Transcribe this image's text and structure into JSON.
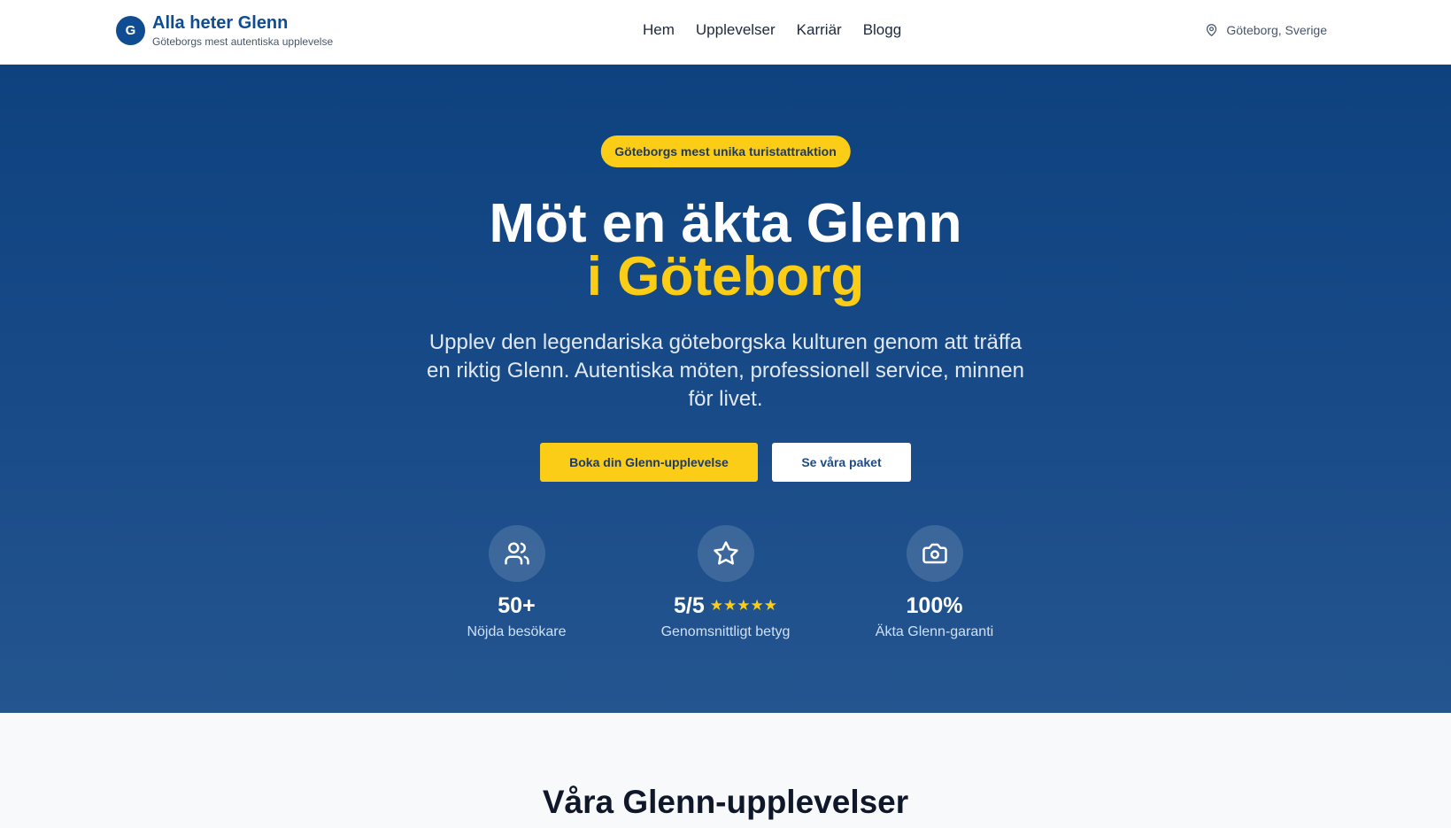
{
  "header": {
    "brand_mark": "G",
    "brand_title": "Alla heter Glenn",
    "brand_subtitle": "Göteborgs mest autentiska upplevelse",
    "nav": [
      "Hem",
      "Upplevelser",
      "Karriär",
      "Blogg"
    ],
    "location": "Göteborg, Sverige",
    "location_icon": "map-pin-icon"
  },
  "hero": {
    "badge": "Göteborgs mest unika turistattraktion",
    "title_line1": "Möt en äkta Glenn",
    "title_line2": "i Göteborg",
    "lead": "Upplev den legendariska göteborgska kulturen genom att träffa en riktig Glenn. Autentiska möten, professionell service, minnen för livet.",
    "primary_cta": "Boka din Glenn-upplevelse",
    "secondary_cta": "Se våra paket",
    "stats": [
      {
        "icon": "users-icon",
        "value": "50+",
        "label": "Nöjda besökare"
      },
      {
        "icon": "star-icon",
        "value": "5/5",
        "stars": "★★★★★",
        "label": "Genomsnittligt betyg"
      },
      {
        "icon": "camera-icon",
        "value": "100%",
        "label": "Äkta Glenn-garanti"
      }
    ]
  },
  "section": {
    "title": "Våra Glenn-upplevelser"
  },
  "colors": {
    "primary": "#0f4c92",
    "accent": "#fbcd16",
    "hero_bg": "#184a88"
  }
}
